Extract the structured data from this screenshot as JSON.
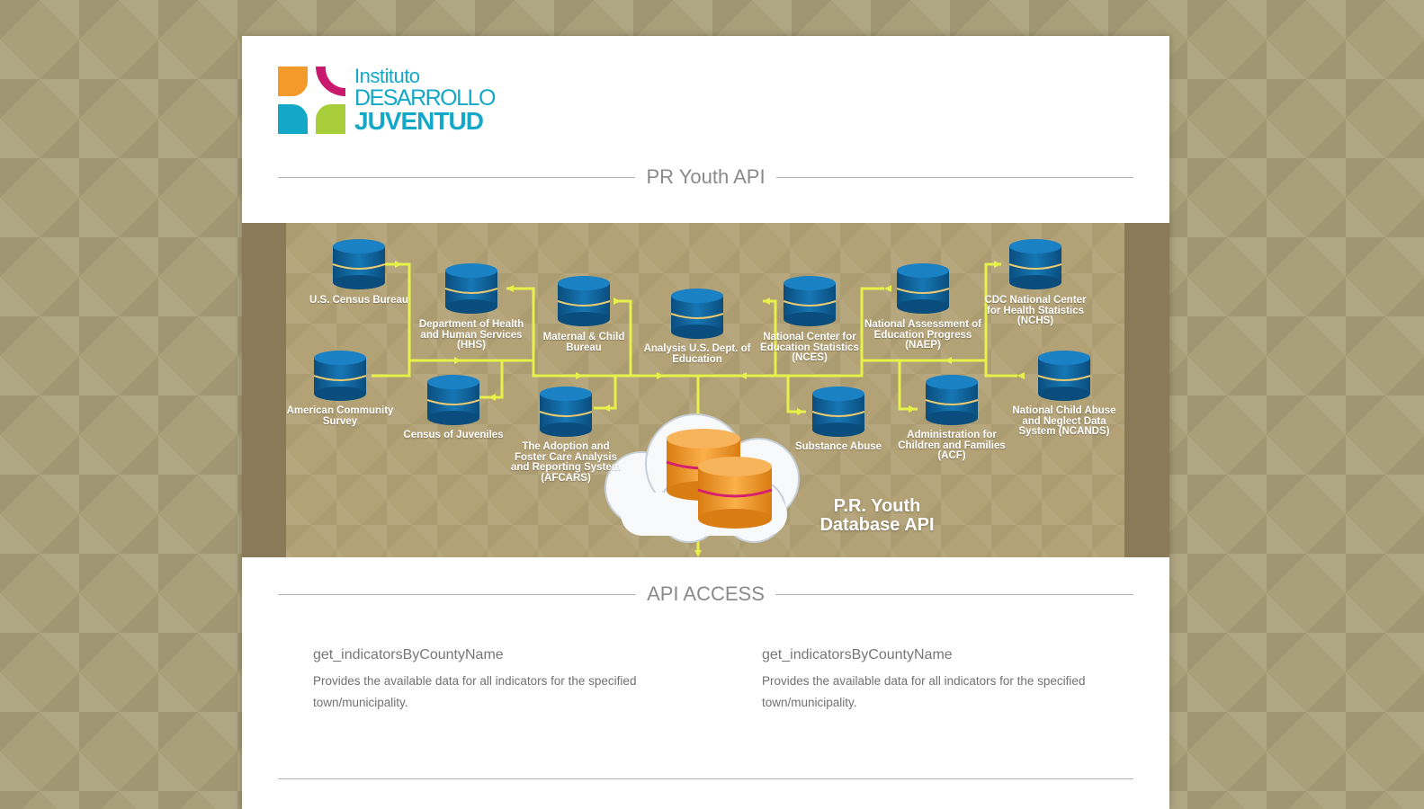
{
  "logo": {
    "line1": "Instituto",
    "line2": "DESARROLLO",
    "line3": "JUVENTUD"
  },
  "header_title": "PR Youth API",
  "diagram": {
    "sources": [
      {
        "label": "U.S. Census Bureau"
      },
      {
        "label": "American Community Survey"
      },
      {
        "label": "Department of Health and Human Services (HHS)"
      },
      {
        "label": "Census of Juveniles"
      },
      {
        "label": "Maternal & Child Bureau"
      },
      {
        "label": "The Adoption and Foster Care Analysis and Reporting System (AFCARS)"
      },
      {
        "label": "Analysis U.S. Dept. of Education"
      },
      {
        "label": "National Center for Education Statistics (NCES)"
      },
      {
        "label": "Substance Abuse"
      },
      {
        "label": "National Assessment of Education Progress (NAEP)"
      },
      {
        "label": "Administration for Children and Families (ACF)"
      },
      {
        "label": "CDC National Center for Health Statistics (NCHS)"
      },
      {
        "label": "National Child Abuse and Neglect Data System (NCANDS)"
      }
    ],
    "database_title": "P.R. Youth Database API"
  },
  "api_section_title": "API ACCESS",
  "api_methods": [
    {
      "name": "get_indicatorsByCountyName",
      "description": "Provides the available data for all indicators for the specified town/municipality."
    },
    {
      "name": "get_indicatorsByCountyName",
      "description": "Provides the available data for all indicators for the specified town/municipality."
    }
  ],
  "colors": {
    "logo_blue": "#14a8c8",
    "logo_orange": "#f39a2b",
    "logo_magenta": "#c8196e",
    "logo_green": "#a8cd3a",
    "db_blue": "#0d5f97",
    "db_orange": "#f29a2a",
    "connector_yellow": "#e8f04a"
  }
}
